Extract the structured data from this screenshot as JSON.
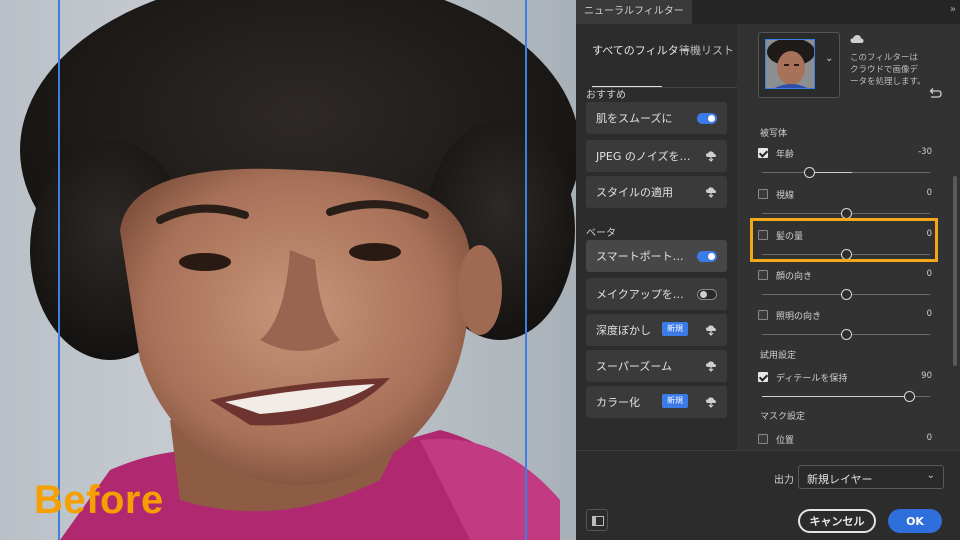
{
  "photo": {
    "before_label": "Before"
  },
  "panel": {
    "tab_title": "ニューラルフィルター",
    "collapse": "»",
    "tabs": {
      "all": "すべてのフィルター",
      "waitlist": "待機リスト"
    },
    "sections": {
      "featured": "おすすめ",
      "beta": "ベータ"
    },
    "featured_filters": [
      {
        "name": "肌をスムーズに",
        "state": "on"
      },
      {
        "name": "JPEG のノイズを…",
        "state": "cloud"
      },
      {
        "name": "スタイルの適用",
        "state": "cloud"
      }
    ],
    "beta_filters": [
      {
        "name": "スマートポート…",
        "state": "on"
      },
      {
        "name": "メイクアップを…",
        "state": "off"
      },
      {
        "name": "深度ぼかし",
        "badge": "新規",
        "state": "cloud"
      },
      {
        "name": "スーパーズーム",
        "state": "cloud"
      },
      {
        "name": "カラー化",
        "badge": "新規",
        "state": "cloud"
      }
    ],
    "cloud_message": "このフィルターはクラウドで画像データを処理します。",
    "groups": {
      "subject": "被写体",
      "trial": "試用設定",
      "mask": "マスク設定"
    },
    "params": [
      {
        "label": "年齢",
        "value": "-30",
        "checked": true,
        "level": 0.3
      },
      {
        "label": "視線",
        "value": "0",
        "checked": false,
        "level": 0.5
      },
      {
        "label": "髪の量",
        "value": "0",
        "checked": false,
        "level": 0.5
      },
      {
        "label": "顔の向き",
        "value": "0",
        "checked": false,
        "level": 0.5
      },
      {
        "label": "照明の向き",
        "value": "0",
        "checked": false,
        "level": 0.5
      },
      {
        "label": "ディテールを保持",
        "value": "90",
        "checked": true,
        "level": 0.9
      },
      {
        "label": "位置",
        "value": "0",
        "checked": false
      }
    ],
    "output_label": "出力",
    "output_value": "新規レイヤー",
    "cancel": "キャンセル",
    "ok": "OK"
  },
  "colors": {
    "accent": "#3b7be8",
    "highlight": "#f3a81b",
    "before_text": "#f5a000"
  }
}
